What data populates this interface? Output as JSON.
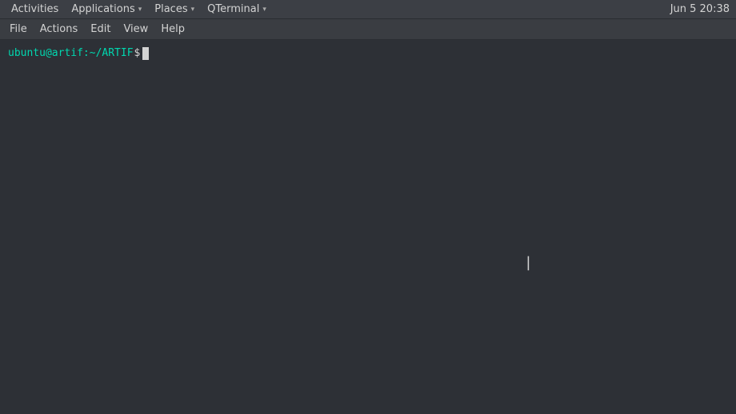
{
  "systemBar": {
    "activities": "Activities",
    "applications": "Applications",
    "applicationsChevron": "▾",
    "places": "Places",
    "placesChevron": "▾",
    "qterminal": "QTerminal",
    "qterminalChevron": "▾",
    "datetime": "Jun 5  20:38"
  },
  "menuBar": {
    "file": "File",
    "actions": "Actions",
    "edit": "Edit",
    "view": "View",
    "help": "Help"
  },
  "terminal": {
    "prompt": "ubuntu@artif:~/ARTIF$"
  }
}
